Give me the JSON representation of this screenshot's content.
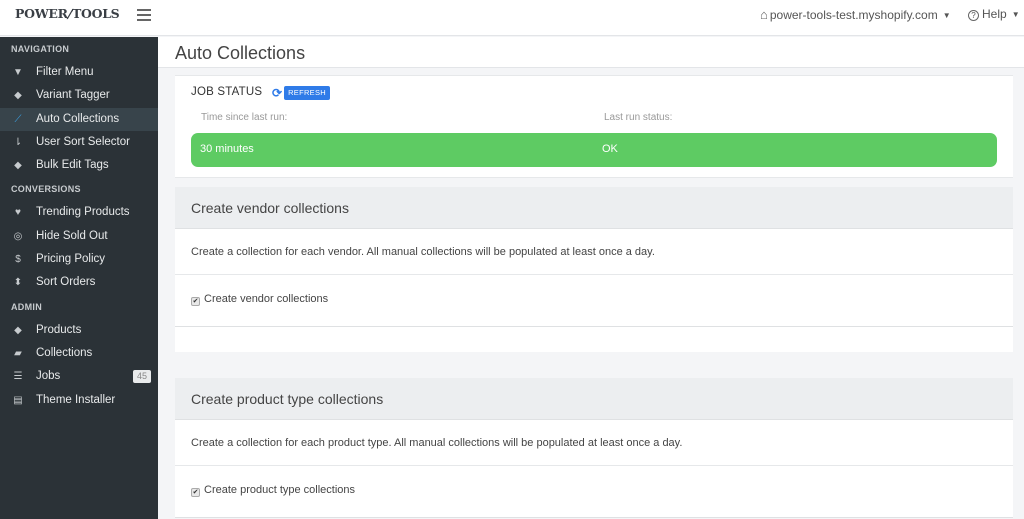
{
  "topbar": {
    "logo_left": "POWER",
    "logo_right": "TOOLS",
    "store_name": "power-tools-test.myshopify.com",
    "help_label": "Help",
    "icons": {
      "home": "home-icon",
      "help": "question-circle-icon",
      "menu": "hamburger-icon"
    }
  },
  "sidebar": {
    "sections": [
      {
        "heading": "NAVIGATION",
        "items": [
          {
            "label": "Filter Menu",
            "icon": "filter-icon"
          },
          {
            "label": "Variant Tagger",
            "icon": "tag-icon"
          },
          {
            "label": "Auto Collections",
            "icon": "magic-wand-icon",
            "active": true
          },
          {
            "label": "User Sort Selector",
            "icon": "sort-icon"
          },
          {
            "label": "Bulk Edit Tags",
            "icon": "tags-icon"
          }
        ]
      },
      {
        "heading": "CONVERSIONS",
        "items": [
          {
            "label": "Trending Products",
            "icon": "heart-icon"
          },
          {
            "label": "Hide Sold Out",
            "icon": "eye-slash-icon"
          },
          {
            "label": "Pricing Policy",
            "icon": "dollar-icon"
          },
          {
            "label": "Sort Orders",
            "icon": "sort-updown-icon"
          }
        ]
      },
      {
        "heading": "ADMIN",
        "items": [
          {
            "label": "Products",
            "icon": "tag-icon"
          },
          {
            "label": "Collections",
            "icon": "folder-open-icon"
          },
          {
            "label": "Jobs",
            "icon": "tasks-icon",
            "badge": "45"
          },
          {
            "label": "Theme Installer",
            "icon": "file-code-icon"
          }
        ]
      }
    ],
    "active_color": "#3ba3e8"
  },
  "main": {
    "page_title": "Auto Collections",
    "job_status": {
      "title": "JOB STATUS",
      "refresh_label": "REFRESH",
      "time_label": "Time since last run:",
      "status_label": "Last run status:",
      "time_value": "30 minutes",
      "status_value": "OK",
      "status_color": "#5ecb63"
    },
    "sections": [
      {
        "title": "Create vendor collections",
        "description": "Create a collection for each vendor. All manual collections will be populated at least once a day.",
        "option_label": "Create vendor collections",
        "checked": true
      },
      {
        "title": "Create product type collections",
        "description": "Create a collection for each product type. All manual collections will be populated at least once a day.",
        "option_label": "Create product type collections",
        "checked": true
      }
    ]
  }
}
